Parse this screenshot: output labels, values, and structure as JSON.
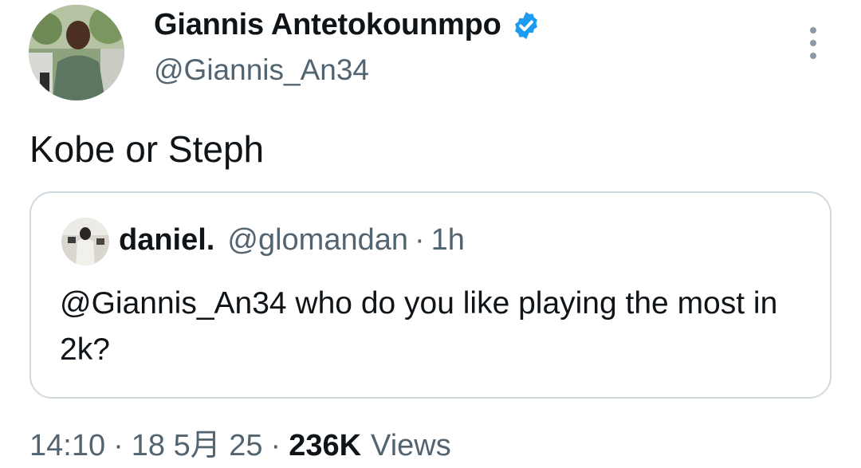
{
  "author": {
    "display_name": "Giannis Antetokounmpo",
    "handle": "@Giannis_An34",
    "verified": true,
    "avatar_icon": "profile-photo"
  },
  "tweet": {
    "text": "Kobe or Steph"
  },
  "quoted_tweet": {
    "display_name": "daniel.",
    "handle": "@glomandan",
    "separator": "·",
    "time": "1h",
    "text": "@Giannis_An34 who do you like playing the most in 2k?"
  },
  "meta": {
    "time": "14:10",
    "date": "18 5月 25",
    "separator": "·",
    "views_count": "236K",
    "views_label": "Views"
  },
  "colors": {
    "verified_blue": "#1d9bf0",
    "secondary_text": "#536471",
    "border": "#cfd9de"
  }
}
